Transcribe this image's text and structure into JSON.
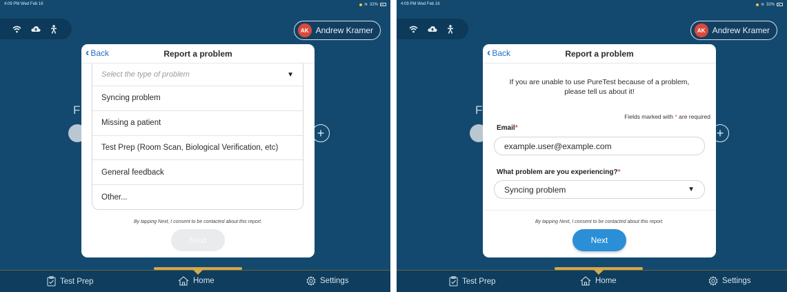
{
  "status_bar": {
    "time": "4:09 PM  Wed Feb 16",
    "battery": "32%"
  },
  "user": {
    "initials": "AK",
    "name": "Andrew Kramer"
  },
  "modal": {
    "back_label": "Back",
    "title": "Report a problem",
    "consent_text": "By tapping Next, I consent to be contacted about this report.",
    "next_label": "Next"
  },
  "left": {
    "dropdown_placeholder": "Select the type of problem",
    "options": [
      "Syncing problem",
      "Missing a patient",
      "Test Prep (Room Scan, Biological Verification, etc)",
      "General feedback",
      "Other..."
    ]
  },
  "right": {
    "intro": "If you are unable to use PureTest because of a problem, please tell us about it!",
    "required_note_prefix": "Fields marked with ",
    "required_star": "*",
    "required_note_suffix": " are required",
    "email_label": "Email",
    "email_value": "example.user@example.com",
    "problem_label": "What problem are you experiencing?",
    "problem_value": "Syncing problem"
  },
  "background": {
    "letter": "F",
    "plus": "+"
  },
  "tabs": [
    {
      "label": "Test Prep",
      "icon": "clipboard-check-icon"
    },
    {
      "label": "Home",
      "icon": "home-icon"
    },
    {
      "label": "Settings",
      "icon": "gear-icon"
    }
  ],
  "colors": {
    "primary": "#2a8fd6",
    "background": "#13496f",
    "accent": "#d3a94b",
    "required": "#e24b3b"
  }
}
